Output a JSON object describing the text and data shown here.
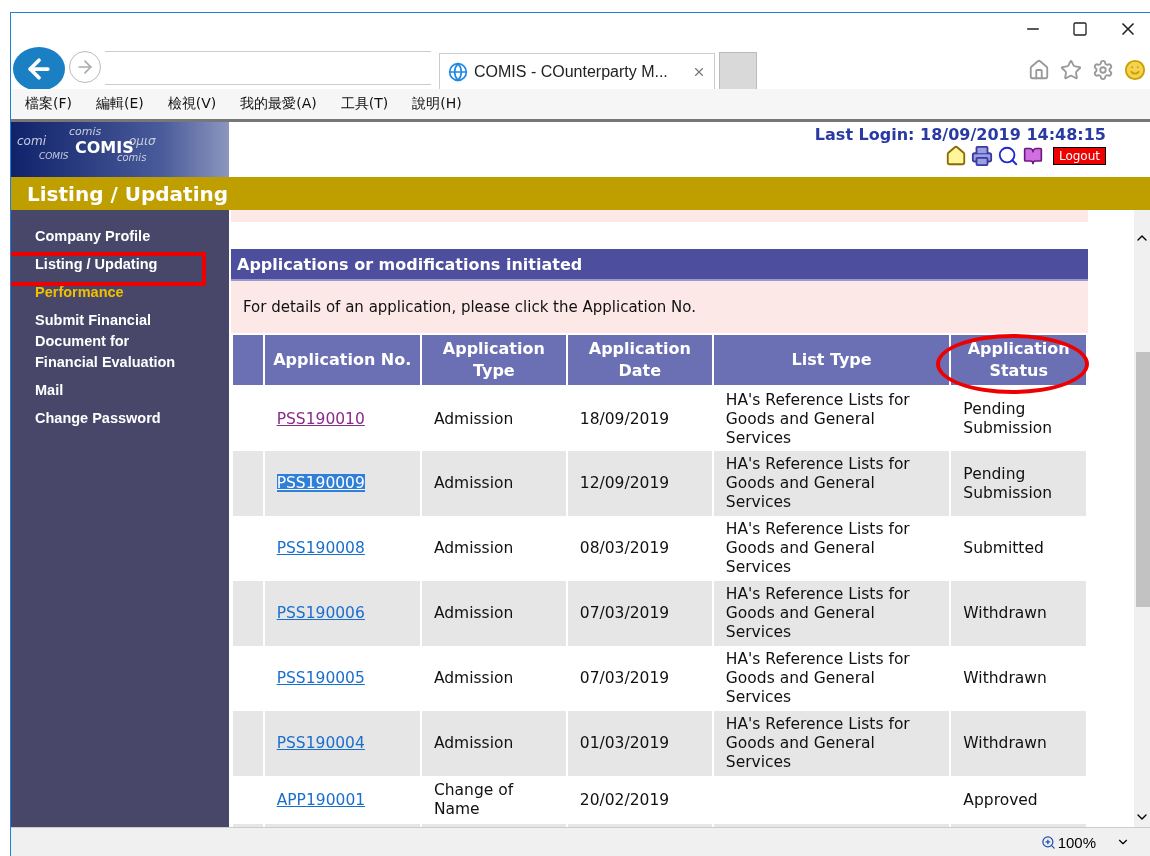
{
  "browser": {
    "tab_title": "COMIS - COunterparty M...",
    "menu": [
      "檔案(F)",
      "編輯(E)",
      "檢視(V)",
      "我的最愛(A)",
      "工具(T)",
      "說明(H)"
    ],
    "zoom": "100%"
  },
  "header": {
    "logo_title": "COMIS",
    "logo_decor": [
      "comis",
      "comi",
      "ομισ",
      "COMIS",
      "comis"
    ],
    "last_login": "Last Login: 18/09/2019 14:48:15",
    "logout": "Logout"
  },
  "page_title": "Listing / Updating",
  "sidebar": [
    {
      "label": "Company Profile",
      "selected": false
    },
    {
      "label": "Listing / Updating",
      "selected": false
    },
    {
      "label": "Performance",
      "selected": true
    },
    {
      "label": "Submit Financial Document for Financial Evaluation",
      "selected": false
    },
    {
      "label": "Mail",
      "selected": false
    },
    {
      "label": "Change Password",
      "selected": false
    }
  ],
  "section": {
    "title": "Applications or modifications initiated",
    "notice": "For details of an application, please click the Application No."
  },
  "table": {
    "columns": [
      "Application No.",
      "Application Type",
      "Application Date",
      "List Type",
      "Application Status"
    ],
    "rows": [
      {
        "app_no": "PSS190010",
        "visited": true,
        "highlighted": false,
        "type": "Admission",
        "date": "18/09/2019",
        "list_type": "HA's Reference Lists for Goods and General Services",
        "status": "Pending Submission"
      },
      {
        "app_no": "PSS190009",
        "visited": false,
        "highlighted": true,
        "type": "Admission",
        "date": "12/09/2019",
        "list_type": "HA's Reference Lists for Goods and General Services",
        "status": "Pending Submission"
      },
      {
        "app_no": "PSS190008",
        "visited": false,
        "highlighted": false,
        "type": "Admission",
        "date": "08/03/2019",
        "list_type": "HA's Reference Lists for Goods and General Services",
        "status": "Submitted"
      },
      {
        "app_no": "PSS190006",
        "visited": false,
        "highlighted": false,
        "type": "Admission",
        "date": "07/03/2019",
        "list_type": "HA's Reference Lists for Goods and General Services",
        "status": "Withdrawn"
      },
      {
        "app_no": "PSS190005",
        "visited": false,
        "highlighted": false,
        "type": "Admission",
        "date": "07/03/2019",
        "list_type": "HA's Reference Lists for Goods and General Services",
        "status": "Withdrawn"
      },
      {
        "app_no": "PSS190004",
        "visited": false,
        "highlighted": false,
        "type": "Admission",
        "date": "01/03/2019",
        "list_type": "HA's Reference Lists for Goods and General Services",
        "status": "Withdrawn"
      },
      {
        "app_no": "APP190001",
        "visited": false,
        "highlighted": false,
        "type": "Change of Name",
        "date": "20/02/2019",
        "list_type": "",
        "status": "Approved"
      }
    ]
  }
}
